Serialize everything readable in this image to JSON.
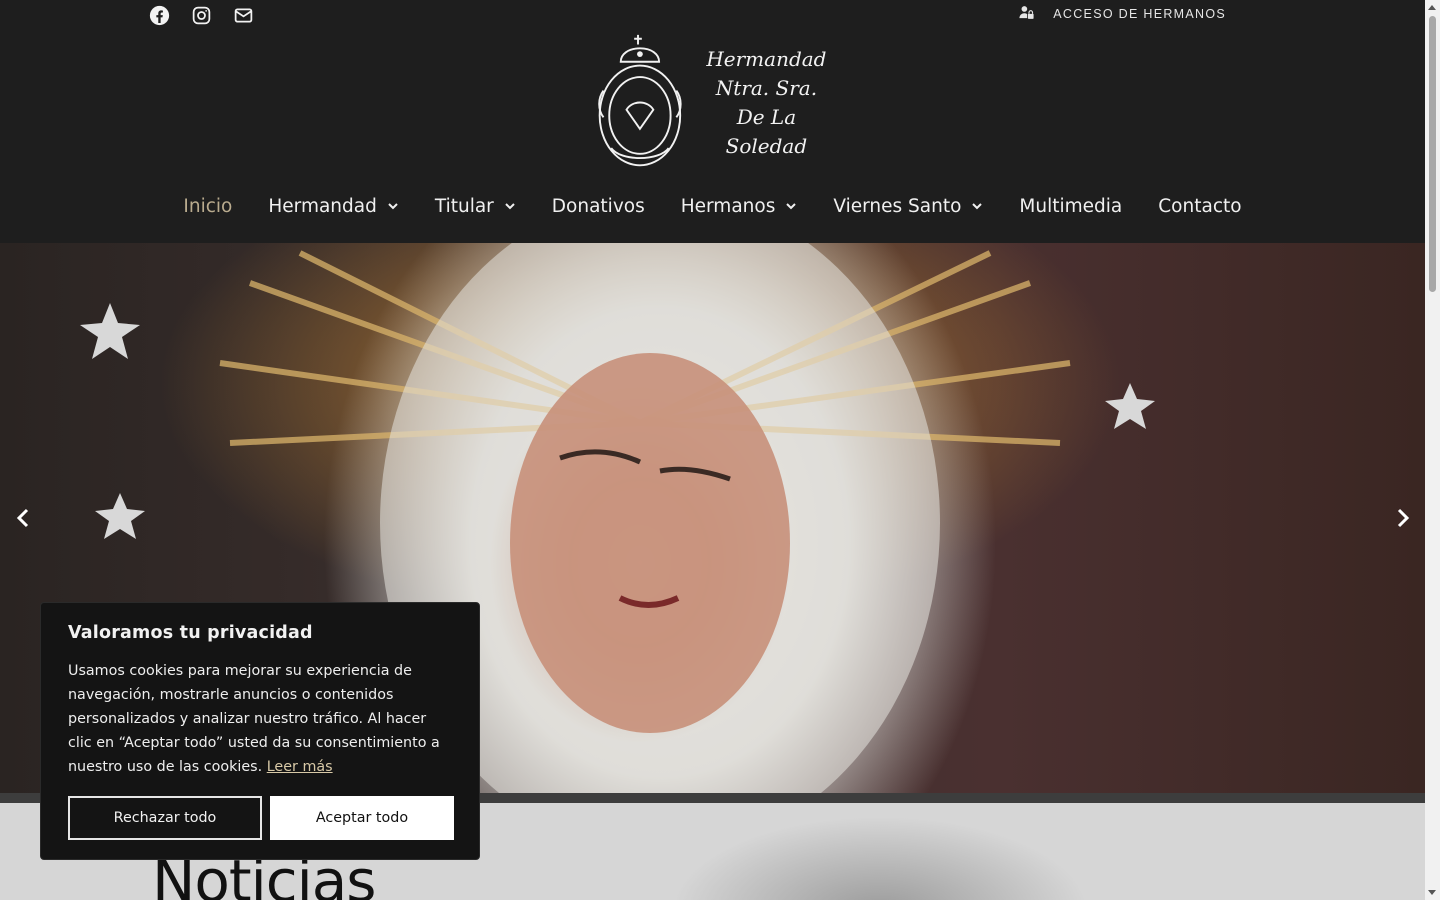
{
  "header": {
    "social": [
      "facebook-icon",
      "instagram-icon",
      "mail-icon"
    ],
    "access_label": "ACCESO DE HERMANOS",
    "logo_lines": [
      "Hermandad",
      "Ntra. Sra.",
      "De La Soledad"
    ]
  },
  "nav": {
    "items": [
      {
        "label": "Inicio",
        "active": true,
        "dropdown": false
      },
      {
        "label": "Hermandad",
        "active": false,
        "dropdown": true
      },
      {
        "label": "Titular",
        "active": false,
        "dropdown": true
      },
      {
        "label": "Donativos",
        "active": false,
        "dropdown": false
      },
      {
        "label": "Hermanos",
        "active": false,
        "dropdown": true
      },
      {
        "label": "Viernes Santo",
        "active": false,
        "dropdown": true
      },
      {
        "label": "Multimedia",
        "active": false,
        "dropdown": false
      },
      {
        "label": "Contacto",
        "active": false,
        "dropdown": false
      }
    ]
  },
  "news": {
    "title": "Noticias"
  },
  "cookie": {
    "title": "Valoramos tu privacidad",
    "body": "Usamos cookies para mejorar su experiencia de navegación, mostrarle anuncios o contenidos personalizados y analizar nuestro tráfico. Al hacer clic en “Aceptar todo” usted da su consentimiento a nuestro uso de las cookies.",
    "link": "Leer más",
    "reject": "Rechazar todo",
    "accept": "Aceptar todo"
  },
  "colors": {
    "accent": "#b9ab8e",
    "header_bg": "#1e1e1e",
    "link": "#d8c9a7"
  }
}
